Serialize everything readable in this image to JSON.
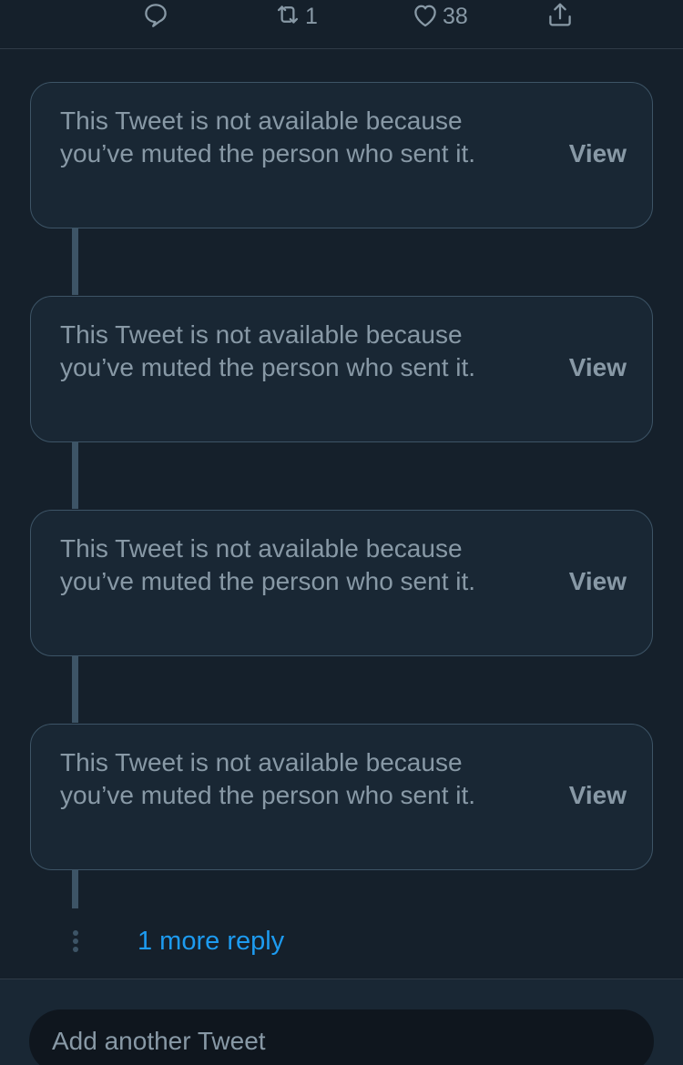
{
  "actions": {
    "reply_count": "",
    "retweet_count": "1",
    "like_count": "38"
  },
  "muted_tweets": [
    {
      "message": "This Tweet is not available because you’ve muted the person who sent it.",
      "view_label": "View"
    },
    {
      "message": "This Tweet is not available because you’ve muted the person who sent it.",
      "view_label": "View"
    },
    {
      "message": "This Tweet is not available because you’ve muted the person who sent it.",
      "view_label": "View"
    },
    {
      "message": "This Tweet is not available because you’ve muted the person who sent it.",
      "view_label": "View"
    }
  ],
  "more_replies_label": "1 more reply",
  "composer": {
    "placeholder": "Add another Tweet"
  },
  "colors": {
    "background": "#15202b",
    "card_background": "#192734",
    "border": "#3d5466",
    "secondary_text": "#8899a6",
    "link": "#1d9bf0"
  }
}
